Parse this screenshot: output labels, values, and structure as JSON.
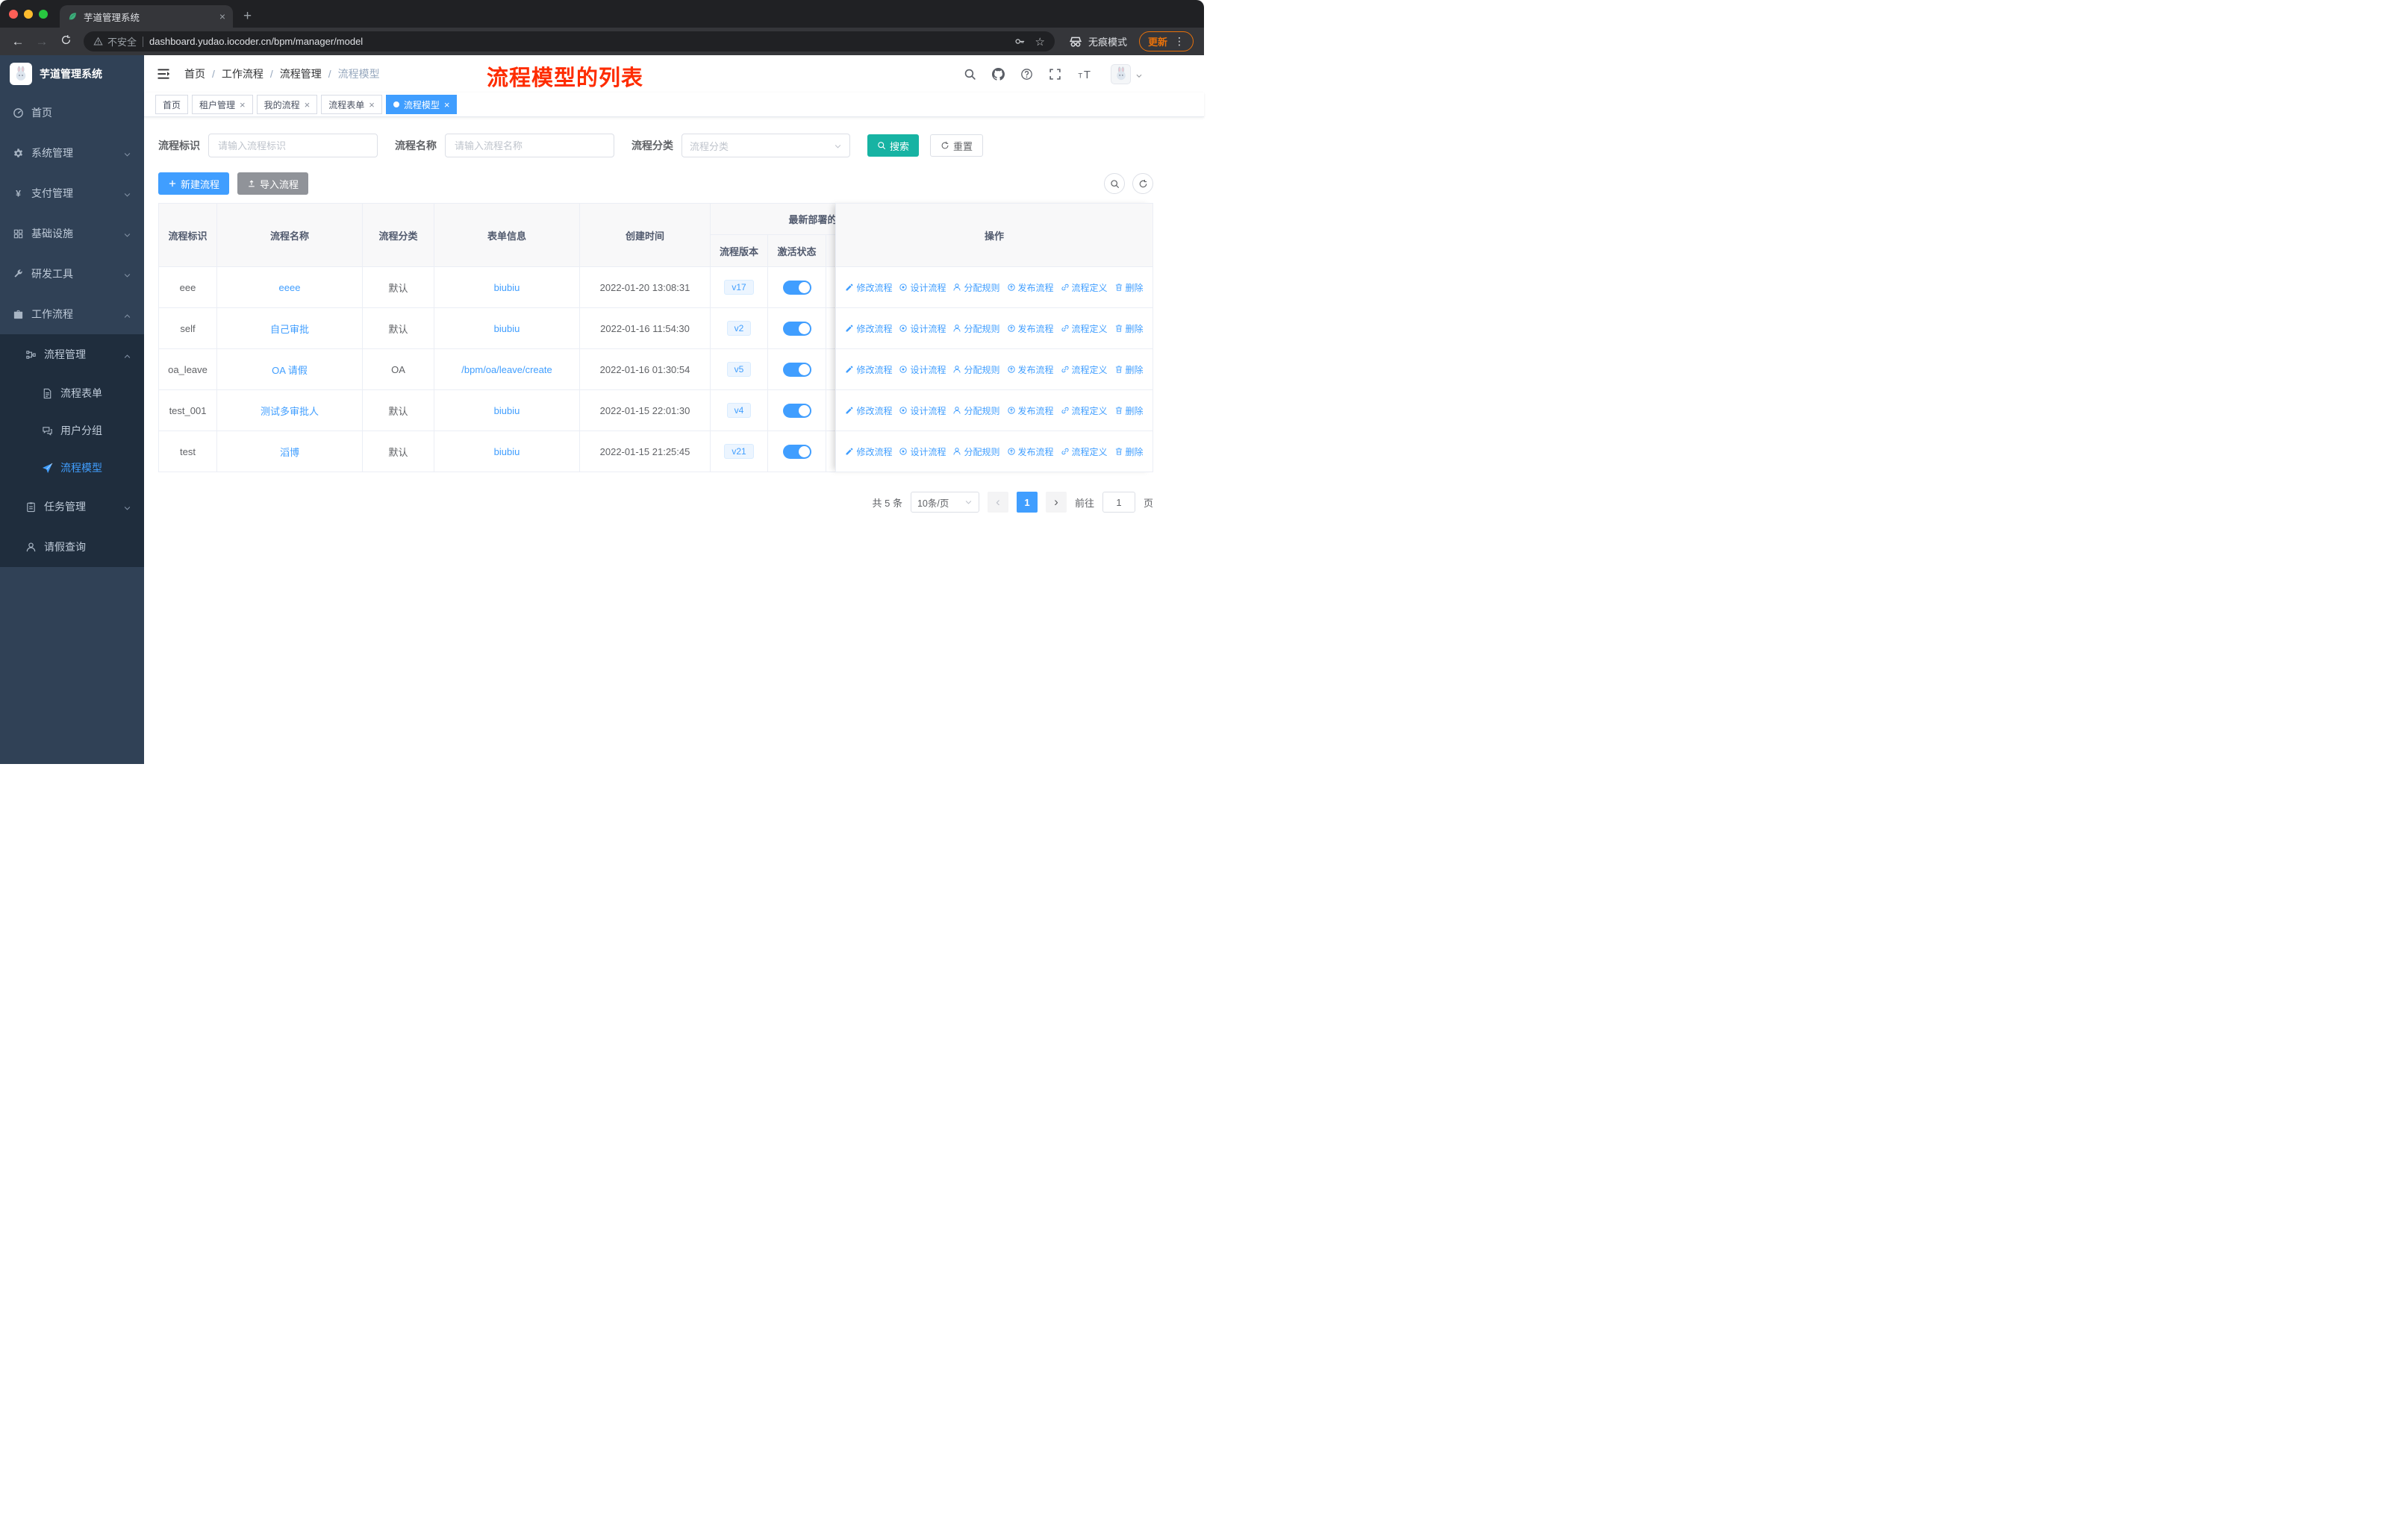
{
  "colors": {
    "primary": "#409eff",
    "search_button": "#17b3a3",
    "sidebar_bg": "#304156",
    "submenu_bg": "#1f2d3d",
    "annotation_red": "#fe2c00",
    "update_badge": "#e8710a",
    "version_tag_bg": "#ecf5ff"
  },
  "browser": {
    "tab_title": "芋道管理系统",
    "security_label": "不安全",
    "url": "dashboard.yudao.iocoder.cn/bpm/manager/model",
    "incognito_label": "无痕模式",
    "update_label": "更新"
  },
  "sidebar": {
    "logo_title": "芋道管理系统",
    "items": [
      {
        "label": "首页"
      },
      {
        "label": "系统管理"
      },
      {
        "label": "支付管理"
      },
      {
        "label": "基础设施"
      },
      {
        "label": "研发工具"
      },
      {
        "label": "工作流程"
      },
      {
        "label": "流程管理"
      },
      {
        "label": "流程表单"
      },
      {
        "label": "用户分组"
      },
      {
        "label": "流程模型"
      },
      {
        "label": "任务管理"
      },
      {
        "label": "请假查询"
      }
    ]
  },
  "header": {
    "breadcrumb": [
      "首页",
      "工作流程",
      "流程管理",
      "流程模型"
    ],
    "annotation": "流程模型的列表"
  },
  "tags": [
    {
      "label": "首页"
    },
    {
      "label": "租户管理"
    },
    {
      "label": "我的流程"
    },
    {
      "label": "流程表单"
    },
    {
      "label": "流程模型"
    }
  ],
  "filters": {
    "id_label": "流程标识",
    "id_placeholder": "请输入流程标识",
    "name_label": "流程名称",
    "name_placeholder": "请输入流程名称",
    "category_label": "流程分类",
    "category_placeholder": "流程分类",
    "search_label": "搜索",
    "reset_label": "重置"
  },
  "toolbar": {
    "create_label": "新建流程",
    "import_label": "导入流程"
  },
  "table": {
    "columns": {
      "id": "流程标识",
      "name": "流程名称",
      "category": "流程分类",
      "form": "表单信息",
      "created": "创建时间",
      "group": "最新部署的",
      "version": "流程版本",
      "active": "激活状态",
      "actions": "操作"
    },
    "row_actions": [
      "修改流程",
      "设计流程",
      "分配规则",
      "发布流程",
      "流程定义",
      "删除"
    ],
    "rows": [
      {
        "id": "eee",
        "name": "eeee",
        "category": "默认",
        "form": "biubiu",
        "created": "2022-01-20 13:08:31",
        "version": "v17",
        "active": true
      },
      {
        "id": "self",
        "name": "自己审批",
        "category": "默认",
        "form": "biubiu",
        "created": "2022-01-16 11:54:30",
        "version": "v2",
        "active": true
      },
      {
        "id": "oa_leave",
        "name": "OA 请假",
        "category": "OA",
        "form": "/bpm/oa/leave/create",
        "created": "2022-01-16 01:30:54",
        "version": "v5",
        "active": true
      },
      {
        "id": "test_001",
        "name": "测试多审批人",
        "category": "默认",
        "form": "biubiu",
        "created": "2022-01-15 22:01:30",
        "version": "v4",
        "active": true
      },
      {
        "id": "test",
        "name": "滔博",
        "category": "默认",
        "form": "biubiu",
        "created": "2022-01-15 21:25:45",
        "version": "v21",
        "active": true
      }
    ]
  },
  "pagination": {
    "total_label": "共 5 条",
    "page_size_label": "10条/页",
    "prev_glyph": "‹",
    "next_glyph": "›",
    "current_page": "1",
    "goto_label": "前往",
    "goto_value": "1",
    "page_unit": "页"
  }
}
